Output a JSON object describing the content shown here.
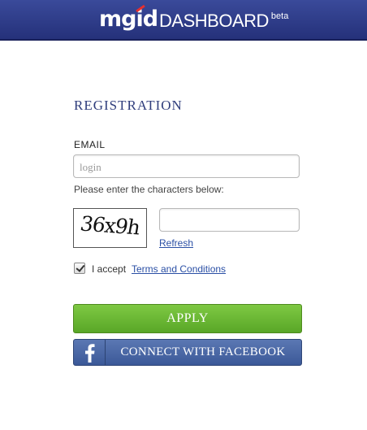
{
  "header": {
    "brand": "mgid",
    "product": "DASHBOARD",
    "badge": "beta"
  },
  "form": {
    "title": "REGISTRATION",
    "email_label": "EMAIL",
    "email_placeholder": "login",
    "email_value": "",
    "captcha_hint": "Please enter the characters below:",
    "captcha_text": "36x9h",
    "captcha_value": "",
    "refresh_label": "Refresh",
    "accept_checked": true,
    "accept_label": "I accept",
    "terms_link": "Terms and Conditions",
    "apply_label": "APPLY",
    "facebook_label": "CONNECT WITH FACEBOOK"
  },
  "colors": {
    "header_bg": "#2f3d88",
    "apply_bg": "#6ab733",
    "facebook_bg": "#4a67a6",
    "link": "#2a4fa5",
    "title": "#2f3d7c"
  },
  "icons": {
    "facebook": "facebook-f-icon",
    "check": "checkmark-icon"
  }
}
